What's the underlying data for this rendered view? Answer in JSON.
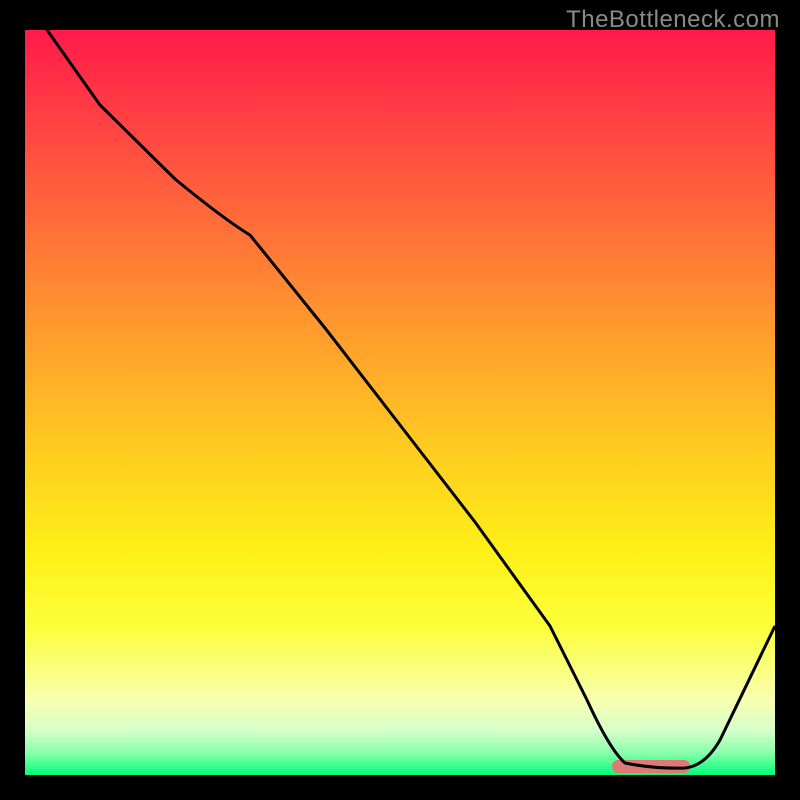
{
  "watermark": "TheBottleneck.com",
  "chart_data": {
    "type": "line",
    "title": "",
    "xlabel": "",
    "ylabel": "",
    "xlim": [
      0,
      100
    ],
    "ylim": [
      0,
      100
    ],
    "x": [
      3,
      10,
      20,
      30,
      40,
      50,
      60,
      70,
      75,
      80,
      85,
      90,
      100
    ],
    "values": [
      100,
      90,
      80,
      73,
      60,
      47,
      34,
      20,
      10,
      3,
      1,
      1,
      20
    ],
    "gradient_stops": [
      {
        "pos": 0,
        "color": "#ff1a4a"
      },
      {
        "pos": 50,
        "color": "#ffc822"
      },
      {
        "pos": 80,
        "color": "#fcff3a"
      },
      {
        "pos": 100,
        "color": "#00ff78"
      }
    ],
    "marker_region": {
      "x_start": 78,
      "x_end": 88,
      "y": 0.5
    }
  }
}
